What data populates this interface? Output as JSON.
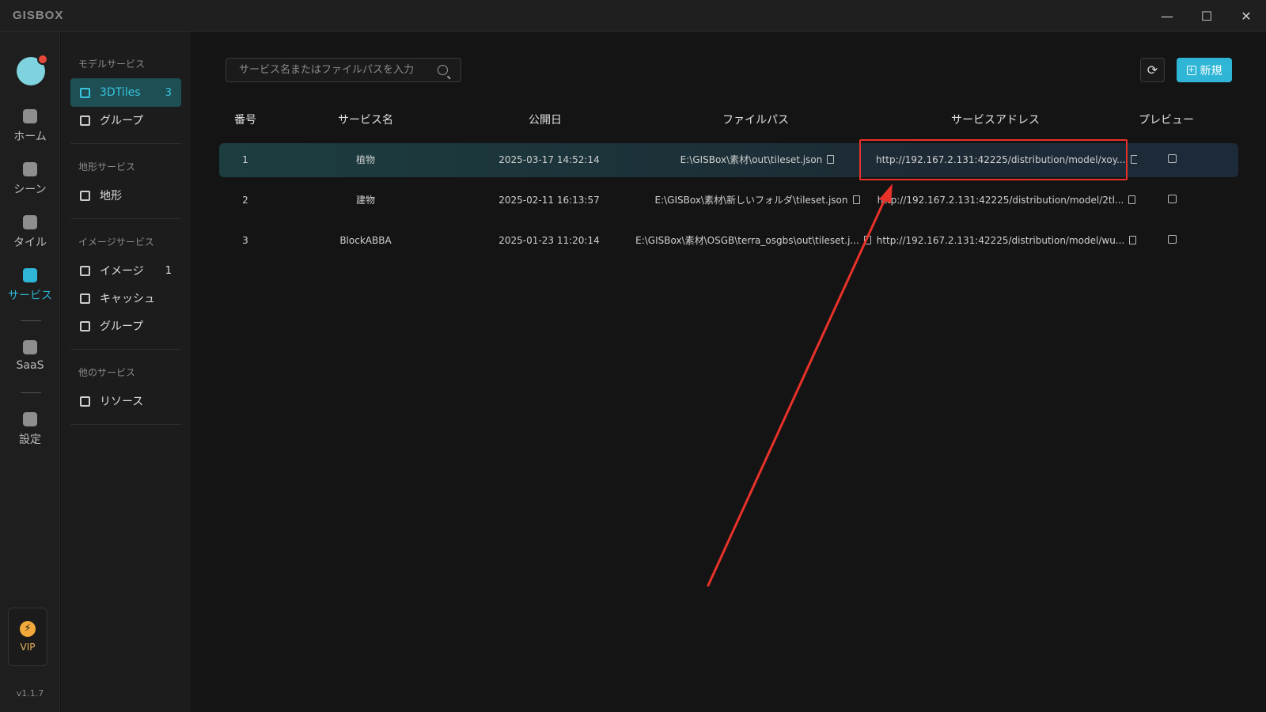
{
  "app": {
    "logo": "GISBOX"
  },
  "window": {
    "minimize": "—",
    "maximize": "☐",
    "close": "✕"
  },
  "rail": {
    "items": [
      {
        "label": "ホーム",
        "icon": "home-icon"
      },
      {
        "label": "シーン",
        "icon": "scene-icon"
      },
      {
        "label": "タイル",
        "icon": "tile-icon"
      },
      {
        "label": "サービス",
        "icon": "service-icon",
        "active": true
      },
      {
        "label": "SaaS",
        "icon": "saas-icon"
      },
      {
        "label": "設定",
        "icon": "settings-icon"
      }
    ],
    "vip": "VIP",
    "version": "v1.1.7"
  },
  "sidebar": {
    "model_title": "モデルサービス",
    "model_items": [
      {
        "label": "3DTiles",
        "count": "3"
      },
      {
        "label": "グループ",
        "count": ""
      }
    ],
    "terrain_title": "地形サービス",
    "terrain_items": [
      {
        "label": "地形"
      }
    ],
    "image_title": "イメージサービス",
    "image_items": [
      {
        "label": "イメージ",
        "count": "1"
      },
      {
        "label": "キャッシュ",
        "count": ""
      },
      {
        "label": "グループ",
        "count": ""
      }
    ],
    "other_title": "他のサービス",
    "other_items": [
      {
        "label": "リソース"
      }
    ]
  },
  "toolbar": {
    "search_placeholder": "サービス名またはファイルパスを入力",
    "refresh_icon": "⟳",
    "new_label": "新規"
  },
  "table": {
    "headers": [
      "番号",
      "サービス名",
      "公開日",
      "ファイルパス",
      "サービスアドレス",
      "プレビュー"
    ],
    "rows": [
      {
        "no": "1",
        "name": "植物",
        "date": "2025-03-17 14:52:14",
        "path": "E:\\GISBox\\素材\\out\\tileset.json",
        "address": "http://192.167.2.131:42225/distribution/model/xoy..."
      },
      {
        "no": "2",
        "name": "建物",
        "date": "2025-02-11 16:13:57",
        "path": "E:\\GISBox\\素材\\新しいフォルダ\\tileset.json",
        "address": "http://192.167.2.131:42225/distribution/model/2tl..."
      },
      {
        "no": "3",
        "name": "BlockABBA",
        "date": "2025-01-23 11:20:14",
        "path": "E:\\GISBox\\素材\\OSGB\\terra_osgbs\\out\\tileset.j...",
        "address": "http://192.167.2.131:42225/distribution/model/wu..."
      }
    ]
  },
  "annotation": {
    "color": "#e8322a"
  }
}
